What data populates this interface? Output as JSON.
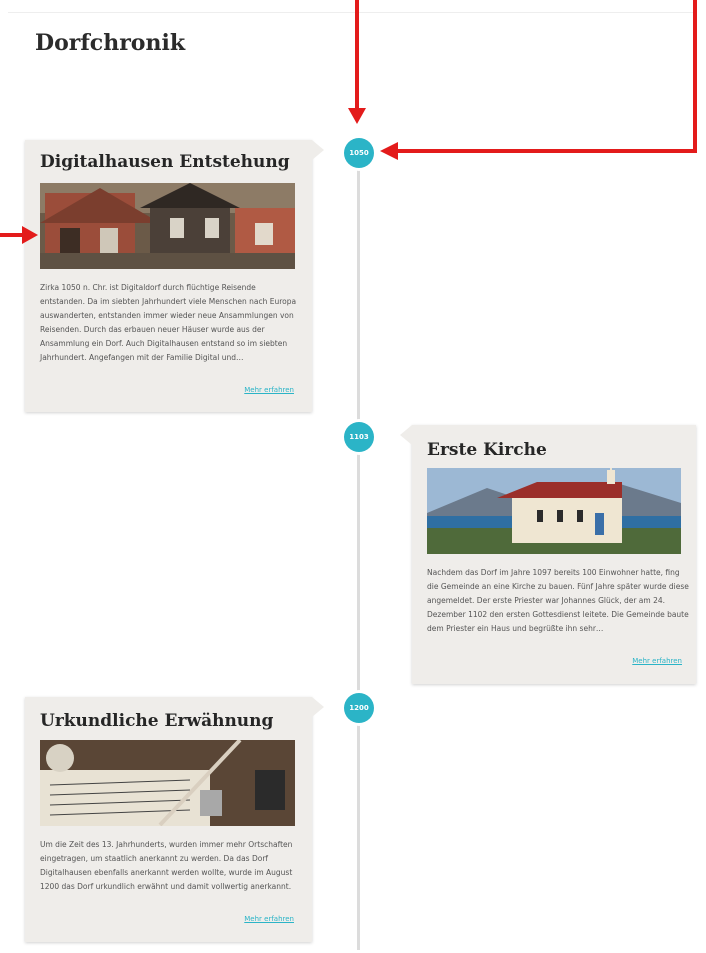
{
  "page": {
    "title": "Dorfchronik"
  },
  "timeline": [
    {
      "year": "1050",
      "title": "Digitalhausen Entstehung",
      "text": "Zirka 1050 n. Chr. ist Digitaldorf durch flüchtige Reisende entstanden. Da im siebten Jahrhundert viele Menschen nach Europa auswanderten, entstanden immer wieder neue Ansammlungen von Reisenden. Durch das erbauen neuer Häuser wurde aus der Ansammlung ein Dorf. Auch Digitalhausen entstand so im siebten Jahrhundert. Angefangen mit der Familie Digital und…",
      "link": "Mehr erfahren"
    },
    {
      "year": "1103",
      "title": "Erste Kirche",
      "text": "Nachdem das Dorf im Jahre 1097 bereits 100 Einwohner hatte, fing die Gemeinde an eine Kirche zu bauen. Fünf Jahre später wurde diese angemeldet. Der erste Priester war Johannes Glück, der am 24. Dezember 1102 den ersten Gottesdienst leitete. Die Gemeinde baute dem Priester ein Haus und begrüßte ihn sehr…",
      "link": "Mehr erfahren"
    },
    {
      "year": "1200",
      "title": "Urkundliche Erwähnung",
      "text": "Um die Zeit des 13. Jahrhunderts, wurden immer mehr Ortschaften eingetragen, um staatlich anerkannt zu werden. Da das Dorf Digitalhausen ebenfalls anerkannt werden wollte, wurde im August 1200 das Dorf urkundlich erwähnt und damit vollwertig anerkannt.",
      "link": "Mehr erfahren"
    }
  ],
  "colors": {
    "accent": "#2bb4c7",
    "card": "#efedea",
    "annotation": "#e31b1b"
  }
}
